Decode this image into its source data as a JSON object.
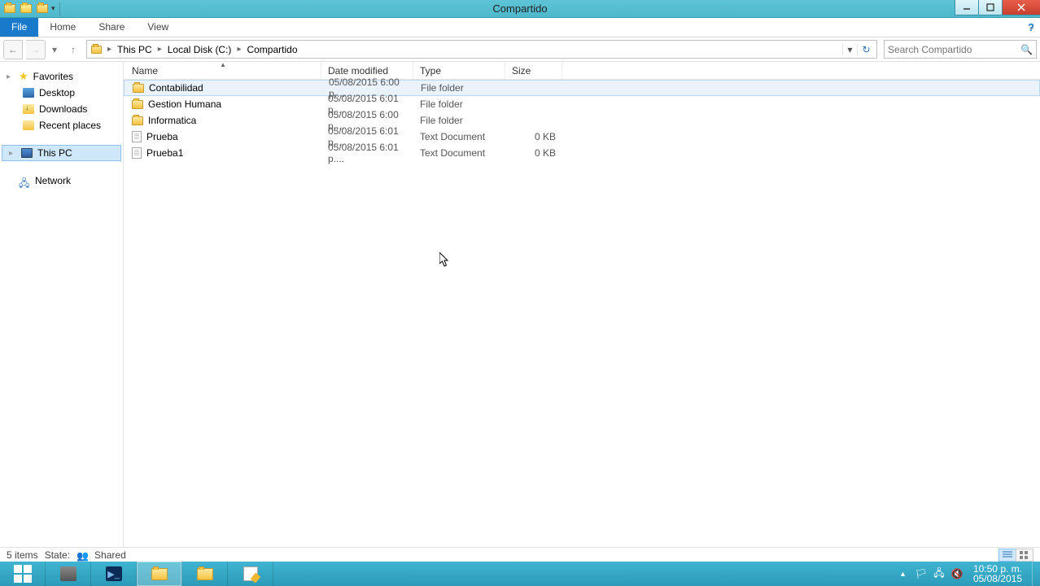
{
  "window": {
    "title": "Compartido"
  },
  "ribbon": {
    "file": "File",
    "tabs": [
      "Home",
      "Share",
      "View"
    ]
  },
  "breadcrumb": {
    "items": [
      "This PC",
      "Local Disk (C:)",
      "Compartido"
    ]
  },
  "search": {
    "placeholder": "Search Compartido"
  },
  "nav_pane": {
    "favorites": {
      "label": "Favorites",
      "items": [
        "Desktop",
        "Downloads",
        "Recent places"
      ]
    },
    "this_pc": "This PC",
    "network": "Network"
  },
  "columns": [
    "Name",
    "Date modified",
    "Type",
    "Size"
  ],
  "files": [
    {
      "name": "Contabilidad",
      "date": "05/08/2015 6:00 p....",
      "type": "File folder",
      "size": "",
      "icon": "folder"
    },
    {
      "name": "Gestion Humana",
      "date": "05/08/2015 6:01 p....",
      "type": "File folder",
      "size": "",
      "icon": "folder"
    },
    {
      "name": "Informatica",
      "date": "05/08/2015 6:00 p....",
      "type": "File folder",
      "size": "",
      "icon": "folder"
    },
    {
      "name": "Prueba",
      "date": "05/08/2015 6:01 p....",
      "type": "Text Document",
      "size": "0 KB",
      "icon": "txt"
    },
    {
      "name": "Prueba1",
      "date": "05/08/2015 6:01 p....",
      "type": "Text Document",
      "size": "0 KB",
      "icon": "txt"
    }
  ],
  "status": {
    "items": "5 items",
    "state_label": "State:",
    "state_value": "Shared"
  },
  "tray": {
    "time": "10:50 p. m.",
    "date": "05/08/2015"
  }
}
